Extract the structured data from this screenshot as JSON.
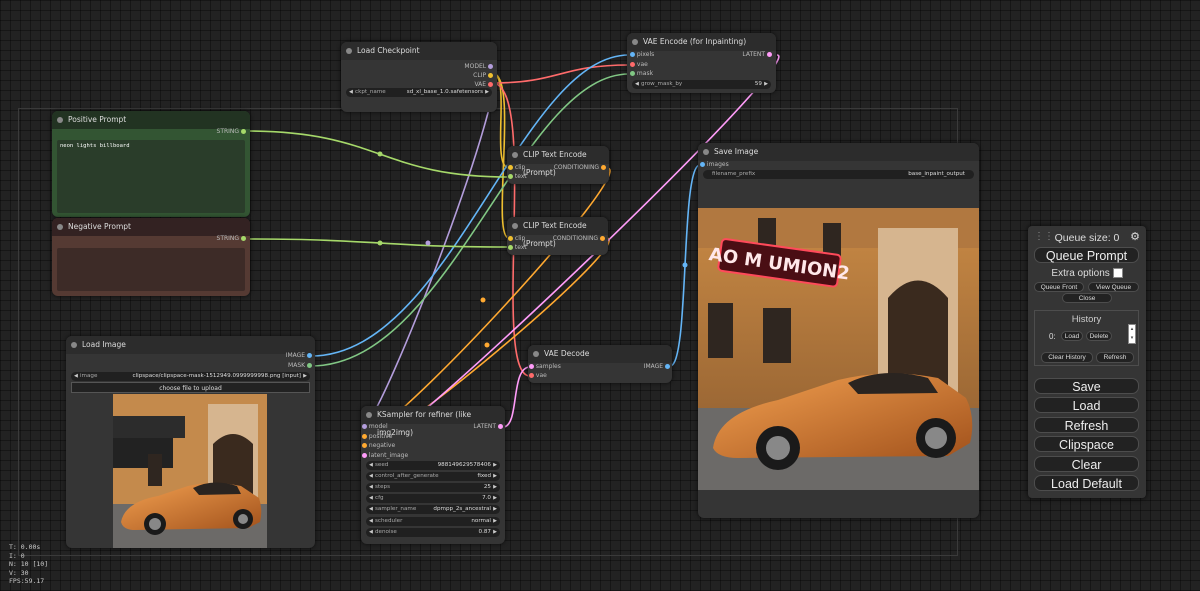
{
  "nodes": {
    "load_checkpoint": {
      "title": "Load Checkpoint",
      "outputs": [
        "MODEL",
        "CLIP",
        "VAE"
      ],
      "widget": {
        "label": "ckpt_name",
        "value": "sd_xl_base_1.0.safetensors"
      }
    },
    "vae_encode_inpaint": {
      "title": "VAE Encode (for Inpainting)",
      "inputs": [
        "pixels",
        "vae",
        "mask"
      ],
      "output": "LATENT",
      "widget": {
        "label": "grow_mask_by",
        "value": "59"
      }
    },
    "positive_prompt": {
      "title": "Positive Prompt",
      "output": "STRING",
      "text": "neon lights billboard"
    },
    "negative_prompt": {
      "title": "Negative Prompt",
      "output": "STRING",
      "text": ""
    },
    "clip_text_encode_1": {
      "title": "CLIP Text Encode (Prompt)",
      "inputs": [
        "clip",
        "text"
      ],
      "output": "CONDITIONING"
    },
    "clip_text_encode_2": {
      "title": "CLIP Text Encode (Prompt)",
      "inputs": [
        "clip",
        "text"
      ],
      "output": "CONDITIONING"
    },
    "save_image": {
      "title": "Save Image",
      "input": "images",
      "widget": {
        "label": "filename_prefix",
        "value": "base_inpaint_output"
      },
      "image_text": "AO M UMION2"
    },
    "load_image": {
      "title": "Load Image",
      "outputs": [
        "IMAGE",
        "MASK"
      ],
      "widget": {
        "label": "image",
        "value": "clipspace/clipspace-mask-1512949.0999999998.png [input]"
      },
      "upload_label": "choose file to upload"
    },
    "vae_decode": {
      "title": "VAE Decode",
      "inputs": [
        "samples",
        "vae"
      ],
      "output": "IMAGE"
    },
    "ksampler": {
      "title": "KSampler for refiner (like img2img)",
      "inputs": [
        "model",
        "positive",
        "negative",
        "latent_image"
      ],
      "output": "LATENT",
      "widgets": [
        {
          "label": "seed",
          "value": "988149629578406"
        },
        {
          "label": "control_after_generate",
          "value": "fixed"
        },
        {
          "label": "steps",
          "value": "25"
        },
        {
          "label": "cfg",
          "value": "7.0"
        },
        {
          "label": "sampler_name",
          "value": "dpmpp_2s_ancestral"
        },
        {
          "label": "scheduler",
          "value": "normal"
        },
        {
          "label": "denoise",
          "value": "0.87"
        }
      ]
    }
  },
  "menu": {
    "queue_size": "Queue size: 0",
    "queue_prompt": "Queue Prompt",
    "extra_options": "Extra options",
    "queue_front": "Queue Front",
    "view_queue": "View Queue",
    "close": "Close",
    "history_title": "History",
    "history_index": "0:",
    "history_load": "Load",
    "history_delete": "Delete",
    "clear_history": "Clear History",
    "refresh_small": "Refresh",
    "buttons": [
      "Save",
      "Load",
      "Refresh",
      "Clipspace",
      "Clear",
      "Load Default"
    ]
  },
  "stats": {
    "t": "T: 0.00s",
    "i": "I: 0",
    "n": "N: 10 [10]",
    "v": "V: 30",
    "fps": "FPS:59.17"
  },
  "colors": {
    "clip_yellow": "#f0c030",
    "vae_red": "#ff6b6b",
    "model_purple": "#b39ddb",
    "image_blue": "#64b5f6",
    "mask_green": "#81c784",
    "latent_pink": "#ff9cf9",
    "conditioning_orange": "#ffa931",
    "string_green": "#a6d96a"
  }
}
